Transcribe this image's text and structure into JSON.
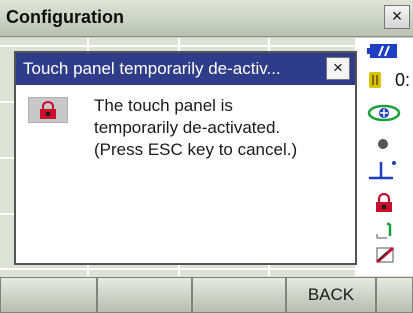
{
  "window": {
    "title": "Configuration",
    "close_label": "×"
  },
  "dialog": {
    "title": "Touch panel temporarily de-activ...",
    "close_label": "×",
    "message_lines": [
      "The touch panel is",
      "temporarily de-activated.",
      "(Press ESC key to cancel.)"
    ],
    "icon": "lock-icon"
  },
  "sidebar": {
    "battery_icon": "battery-icon",
    "memory_icon": "memory-icon",
    "memory_value": "0:",
    "tilt_icon": "tilt-compensation-icon",
    "target_icon": "target-dot-icon",
    "laser_plummet_icon": "laser-plummet-icon",
    "lock_icon": "lock-icon",
    "input_mode_icon": "input-mode-icon",
    "pen_icon": "pen-disabled-icon"
  },
  "softkeys": {
    "keys": [
      "",
      "",
      "",
      "BACK",
      ""
    ]
  },
  "colors": {
    "dialog_title_bg": "#2f3c89",
    "battery": "#1d3ec2",
    "lock": "#c8102e"
  }
}
